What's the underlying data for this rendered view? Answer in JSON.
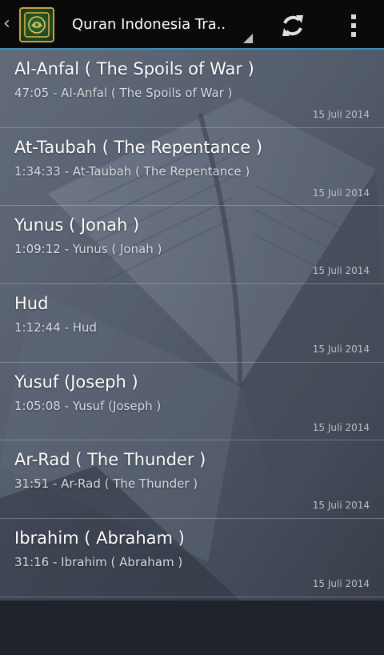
{
  "actionbar": {
    "title": "Quran Indonesia Tra..",
    "up_icon": "chevron-left-icon",
    "app_icon": "quran-app-icon",
    "refresh_icon": "refresh-icon",
    "overflow_icon": "overflow-menu-icon",
    "accent_color": "#3a8fb8"
  },
  "items": [
    {
      "title": "Al-Anfal ( The Spoils of War )",
      "subtitle": "47:05 - Al-Anfal ( The Spoils of War )",
      "date": "15 Juli 2014"
    },
    {
      "title": "At-Taubah ( The Repentance )",
      "subtitle": "1:34:33 - At-Taubah ( The Repentance )",
      "date": "15 Juli 2014"
    },
    {
      "title": "Yunus ( Jonah )",
      "subtitle": "1:09:12 - Yunus ( Jonah )",
      "date": "15 Juli 2014"
    },
    {
      "title": "Hud",
      "subtitle": "1:12:44 - Hud",
      "date": "15 Juli 2014"
    },
    {
      "title": "Yusuf (Joseph )",
      "subtitle": "1:05:08 - Yusuf (Joseph )",
      "date": "15 Juli 2014"
    },
    {
      "title": "Ar-Rad ( The Thunder )",
      "subtitle": "31:51 - Ar-Rad ( The Thunder )",
      "date": "15 Juli 2014"
    },
    {
      "title": "Ibrahim ( Abraham )",
      "subtitle": "31:16 - Ibrahim ( Abraham )",
      "date": "15 Juli 2014"
    }
  ]
}
